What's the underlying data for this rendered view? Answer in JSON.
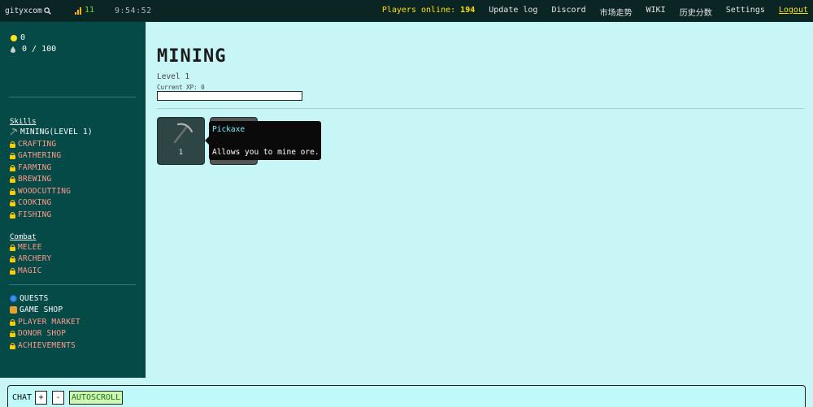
{
  "topbar": {
    "username": "gityxcom",
    "ping": "11",
    "time": "9:54:52",
    "players_online_label": "Players online:",
    "players_online_count": "194",
    "links": [
      "Update log",
      "Discord",
      "市场走势",
      "WIKI",
      "历史分数",
      "Settings"
    ],
    "logout": "Logout"
  },
  "resources": {
    "coins": "0",
    "essence": "0 / 100"
  },
  "sidebar": {
    "skills_title": "Skills",
    "skills": [
      {
        "label": "MINING(LEVEL 1)",
        "locked": false
      },
      {
        "label": "CRAFTING",
        "locked": true
      },
      {
        "label": "GATHERING",
        "locked": true
      },
      {
        "label": "FARMING",
        "locked": true
      },
      {
        "label": "BREWING",
        "locked": true
      },
      {
        "label": "WOODCUTTING",
        "locked": true
      },
      {
        "label": "COOKING",
        "locked": true
      },
      {
        "label": "FISHING",
        "locked": true
      }
    ],
    "combat_title": "Combat",
    "combat": [
      {
        "label": "MELEE",
        "locked": true
      },
      {
        "label": "ARCHERY",
        "locked": true
      },
      {
        "label": "MAGIC",
        "locked": true
      }
    ],
    "misc": [
      {
        "label": "QUESTS",
        "icon": "globe-icon"
      },
      {
        "label": "GAME SHOP",
        "icon": "shop-icon"
      },
      {
        "label": "PLAYER MARKET",
        "icon": "lock-icon"
      },
      {
        "label": "DONOR SHOP",
        "icon": "lock-icon"
      },
      {
        "label": "ACHIEVEMENTS",
        "icon": "lock-icon"
      }
    ]
  },
  "main": {
    "title": "MINING",
    "level": "Level 1",
    "current_xp": "Current XP:  0",
    "xp_progress": 0,
    "tool_count": "1",
    "tooltip": {
      "title": "Pickaxe",
      "description": "Allows you to mine ore."
    }
  },
  "chat": {
    "label": "CHAT",
    "plus": "+",
    "minus": "-",
    "autoscroll": "AUTOSCROLL"
  },
  "colors": {
    "topbar_bg": "#0b2424",
    "sidebar_bg": "#054a47",
    "main_bg": "#c8f6f6",
    "accent_yellow": "#ffe100",
    "locked_text": "#ff9a8a",
    "tooltip_title": "#6ff0ff"
  }
}
